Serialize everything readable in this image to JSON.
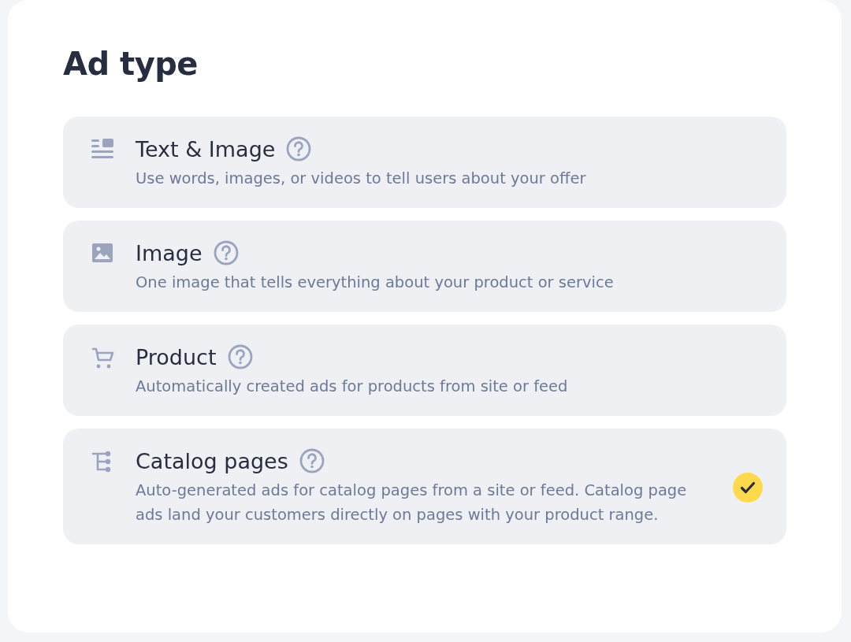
{
  "title": "Ad type",
  "options": [
    {
      "kind": "text-image",
      "title": "Text & Image",
      "description": "Use words, images, or videos to tell users about your offer",
      "selected": false
    },
    {
      "kind": "image",
      "title": "Image",
      "description": "One image that tells everything about your product or service",
      "selected": false
    },
    {
      "kind": "product",
      "title": "Product",
      "description": "Automatically created ads for products from site or feed",
      "selected": false
    },
    {
      "kind": "catalog",
      "title": "Catalog pages",
      "description": "Auto-generated ads for catalog pages from a site or feed. Catalog page ads land your customers directly on pages with your product range.",
      "selected": true
    }
  ]
}
